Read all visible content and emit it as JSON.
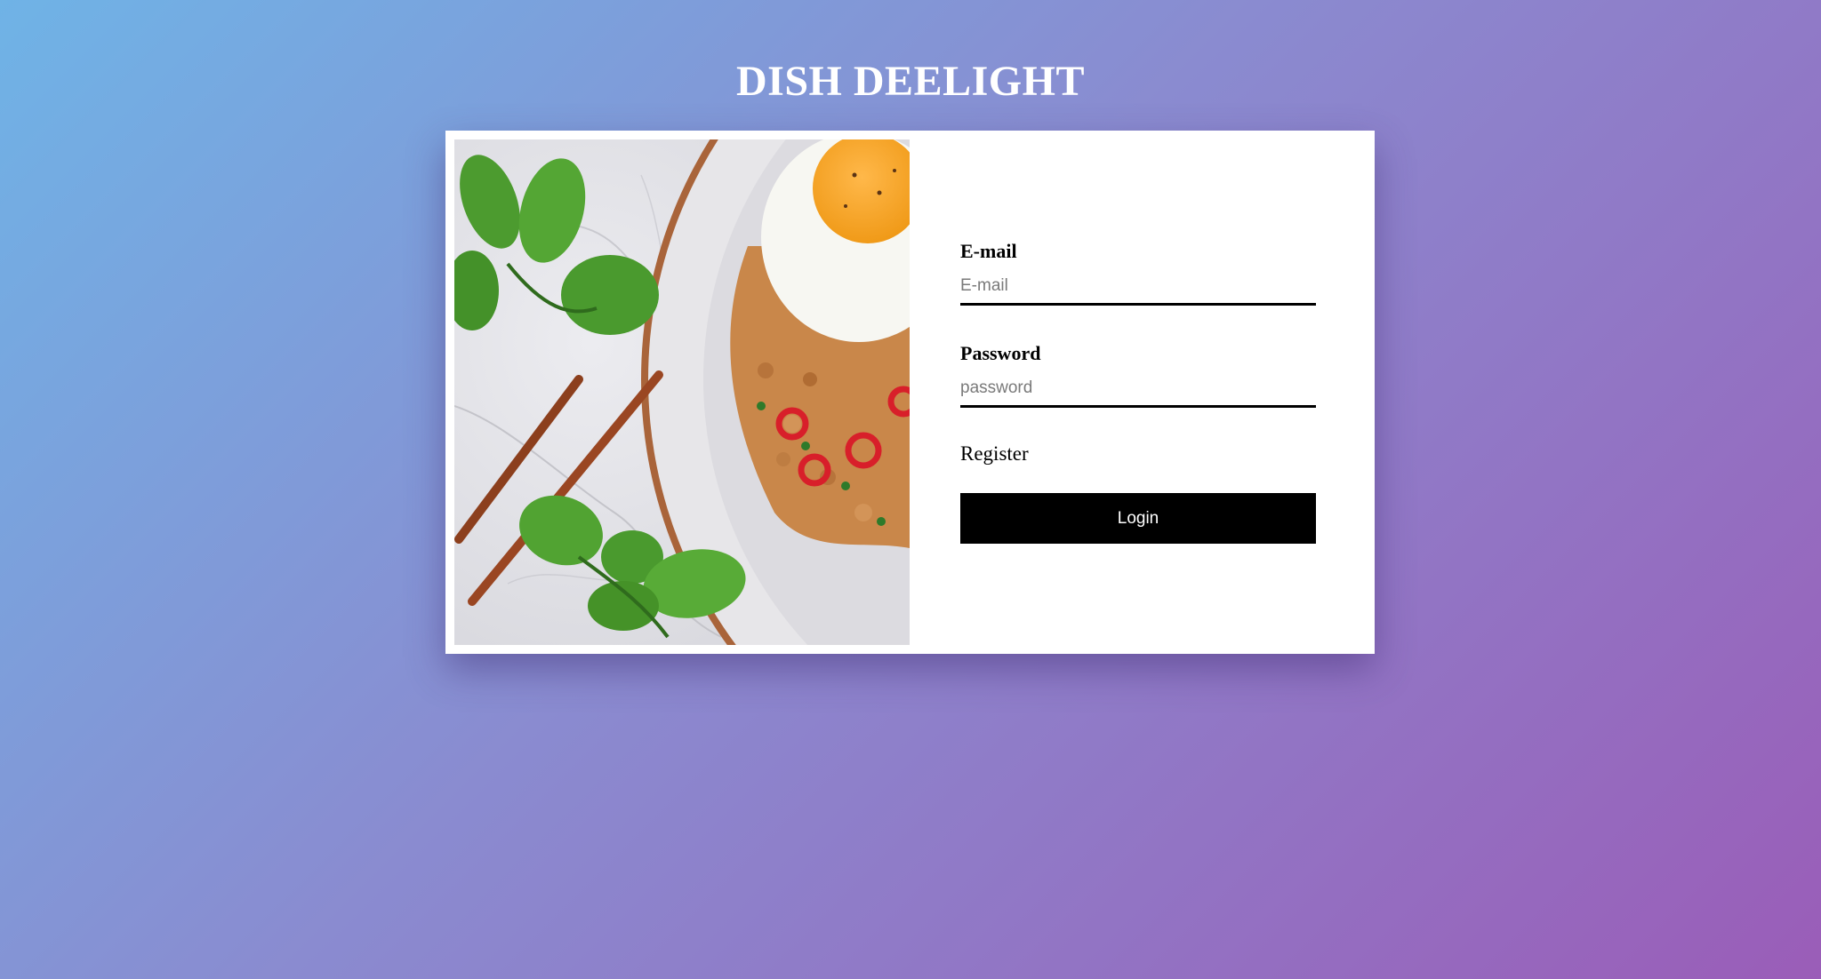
{
  "header": {
    "title": "DISH DEELIGHT"
  },
  "login_form": {
    "email_label": "E-mail",
    "email_placeholder": "E-mail",
    "email_value": "",
    "password_label": "Password",
    "password_placeholder": "password",
    "password_value": "",
    "register_link": "Register",
    "login_button": "Login"
  },
  "colors": {
    "background_gradient_start": "#6fb3e6",
    "background_gradient_end": "#9a5db8",
    "button_background": "#000000",
    "button_text": "#ffffff",
    "card_background": "#ffffff"
  }
}
